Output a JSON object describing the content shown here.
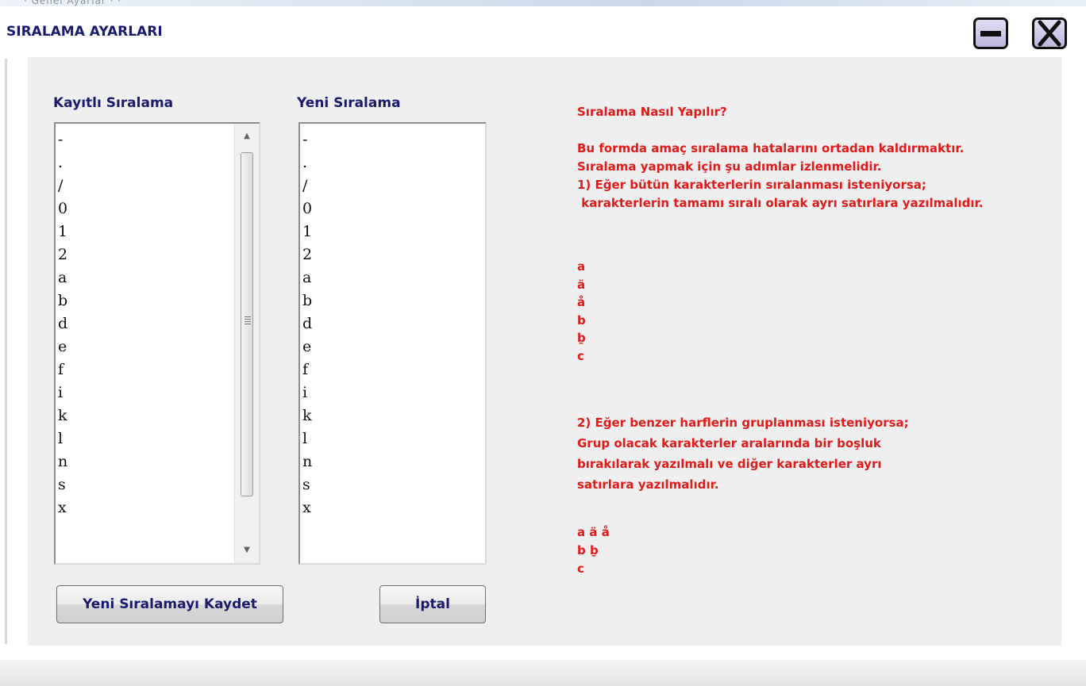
{
  "window": {
    "title": "SIRALAMA AYARLARI",
    "top_strip_text": "· Genel Ayarlar · ·"
  },
  "saved_sort": {
    "label": "Kayıtlı Sıralama",
    "items": [
      "-",
      ".",
      "/",
      "0",
      "1",
      "2",
      "a",
      "b",
      "d",
      "e",
      "f",
      "i",
      "k",
      "l",
      "n",
      "s",
      "x"
    ]
  },
  "new_sort": {
    "label": "Yeni Sıralama",
    "items": [
      "-",
      ".",
      "/",
      "0",
      "1",
      "2",
      "a",
      "b",
      "d",
      "e",
      "f",
      "i",
      "k",
      "l",
      "n",
      "s",
      "x"
    ]
  },
  "buttons": {
    "save_label": "Yeni Sıralamayı Kaydet",
    "cancel_label": "İptal"
  },
  "help": {
    "title": "Sıralama Nasıl Yapılır?",
    "intro_lines": [
      "Bu formda amaç sıralama hatalarını ortadan kaldırmaktır.",
      "Sıralama yapmak için şu adımlar izlenmelidir.",
      "1) Eğer bütün karakterlerin sıralanması isteniyorsa;",
      " karakterlerin tamamı sıralı olarak ayrı satırlara yazılmalıdır."
    ],
    "example1_lines": [
      "a",
      "ä",
      "å",
      "b",
      "ḇ",
      "c"
    ],
    "step2_lines": [
      "2) Eğer benzer harflerin gruplanması isteniyorsa;",
      "Grup olacak karakterler aralarında bir boşluk",
      "bırakılarak yazılmalı ve diğer karakterler ayrı",
      "satırlara yazılmalıdır."
    ],
    "example2_lines": [
      "a ä å",
      "b ḇ",
      "c"
    ]
  },
  "colors": {
    "title": "#1a1a6e",
    "help_text": "#e11a1a",
    "panel": "#efefef"
  }
}
